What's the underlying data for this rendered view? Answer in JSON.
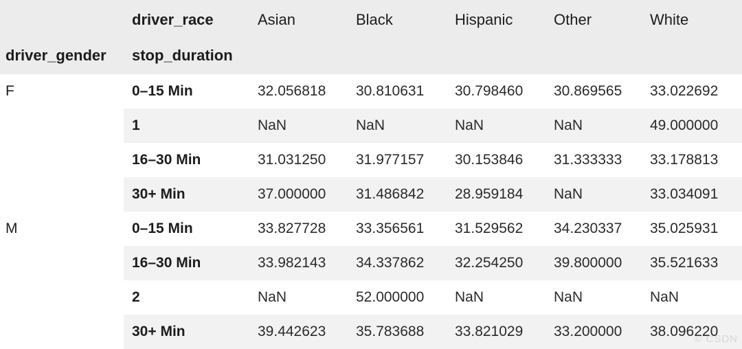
{
  "table": {
    "index_names": {
      "outer": "driver_gender",
      "inner": "stop_duration"
    },
    "columns_name": "driver_race",
    "columns": [
      "Asian",
      "Black",
      "Hispanic",
      "Other",
      "White"
    ],
    "rows": [
      {
        "outer": "F",
        "inner": "0–15 Min",
        "values": [
          "32.056818",
          "30.810631",
          "30.798460",
          "30.869565",
          "33.022692"
        ],
        "striped": false
      },
      {
        "outer": "",
        "inner": "1",
        "values": [
          "NaN",
          "NaN",
          "NaN",
          "NaN",
          "49.000000"
        ],
        "striped": true
      },
      {
        "outer": "",
        "inner": "16–30 Min",
        "values": [
          "31.031250",
          "31.977157",
          "30.153846",
          "31.333333",
          "33.178813"
        ],
        "striped": false
      },
      {
        "outer": "",
        "inner": "30+ Min",
        "values": [
          "37.000000",
          "31.486842",
          "28.959184",
          "NaN",
          "33.034091"
        ],
        "striped": true
      },
      {
        "outer": "M",
        "inner": "0–15 Min",
        "values": [
          "33.827728",
          "33.356561",
          "31.529562",
          "34.230337",
          "35.025931"
        ],
        "striped": false
      },
      {
        "outer": "",
        "inner": "16–30 Min",
        "values": [
          "33.982143",
          "34.337862",
          "32.254250",
          "39.800000",
          "35.521633"
        ],
        "striped": true
      },
      {
        "outer": "",
        "inner": "2",
        "values": [
          "NaN",
          "52.000000",
          "NaN",
          "NaN",
          "NaN"
        ],
        "striped": false
      },
      {
        "outer": "",
        "inner": "30+ Min",
        "values": [
          "39.442623",
          "35.783688",
          "33.821029",
          "33.200000",
          "38.096220"
        ],
        "striped": true
      }
    ]
  },
  "watermark": {
    "text": "© CSDN"
  },
  "colors": {
    "header_background": "#ececec",
    "stripe_background": "#f2f2f2",
    "page_background": "#ffffff",
    "text": "#1c1c1c"
  }
}
